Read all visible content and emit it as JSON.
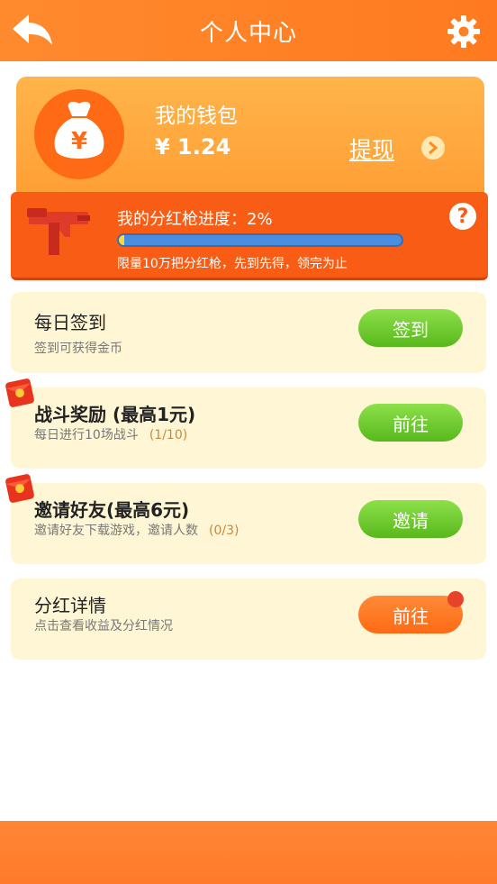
{
  "header": {
    "title": "个人中心"
  },
  "wallet": {
    "title": "我的钱包",
    "amount": "¥ 1.24",
    "withdraw_label": "提现",
    "icon_symbol": "¥"
  },
  "progress": {
    "label": "我的分红枪进度：2%",
    "percent": 2,
    "note": "限量10万把分红枪，先到先得，领完为止",
    "help": "?"
  },
  "tasks": [
    {
      "title": "每日签到",
      "desc": "签到可获得金币",
      "count": "",
      "button": "签到"
    },
    {
      "title": "战斗奖励  (最高1元)",
      "desc": "每日进行10场战斗",
      "count": "(1/10)",
      "button": "前往"
    },
    {
      "title": "邀请好友(最高6元)",
      "desc": "邀请好友下载游戏，邀请人数",
      "count": "(0/3)",
      "button": "邀请"
    },
    {
      "title": "分红详情",
      "desc": "点击查看收益及分红情况",
      "count": "",
      "button": "前往"
    }
  ],
  "colors": {
    "accent": "#ff7a1e",
    "progress_bg": "#f95c14",
    "green": "#58b81c",
    "card": "#fff6d6"
  }
}
